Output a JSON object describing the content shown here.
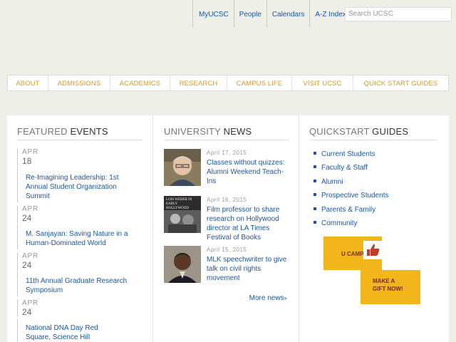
{
  "utility": {
    "links": [
      "MyUCSC",
      "People",
      "Calendars",
      "A-Z Index"
    ],
    "search_placeholder": "Search UCSC"
  },
  "nav": {
    "items": [
      "ABOUT",
      "ADMISSIONS",
      "ACADEMICS",
      "RESEARCH",
      "CAMPUS LIFE",
      "VISIT UCSC",
      "QUICK START GUIDES"
    ]
  },
  "events": {
    "heading_light": "FEATURED ",
    "heading_strong": "EVENTS",
    "items": [
      {
        "month": "APR",
        "day": "18",
        "title": "Re-Imagining Leadership: 1st Annual Student Organization Summit"
      },
      {
        "month": "APR",
        "day": "24",
        "title": "M. Sanjayan: Saving Nature in a Human-Dominated World"
      },
      {
        "month": "APR",
        "day": "24",
        "title": "11th Annual Graduate Research Symposium"
      },
      {
        "month": "APR",
        "day": "24",
        "title": "National DNA Day Red Square, Science Hill"
      }
    ]
  },
  "news": {
    "heading_light": "UNIVERSITY ",
    "heading_strong": "NEWS",
    "items": [
      {
        "date": "April 17, 2015",
        "title": "Classes without quizzes: Alumni Weekend Teach-Ins",
        "thumb_icon": "portrait-photo-icon"
      },
      {
        "date": "April 16, 2015",
        "title": "Film professor to share research on Hollywood director at LA Times Festival of Books",
        "thumb_icon": "book-cover-icon",
        "thumb_text": "LOIS WEBER IN EARLY HOLLYWOOD"
      },
      {
        "date": "April 15, 2015",
        "title": "MLK speechwriter to give talk on civil rights movement",
        "thumb_icon": "portrait-photo-icon"
      }
    ],
    "more_label": "More news",
    "more_suffix": "»"
  },
  "quickstart": {
    "heading_light": "QUICKSTART ",
    "heading_strong": "GUIDES",
    "items": [
      "Current Students",
      "Faculty & Staff",
      "Alumni",
      "Prospective Students",
      "Parents & Family",
      "Community"
    ],
    "promo1_text": "U CAMPA",
    "promo1_icon": "thumbs-up-icon",
    "promo2_line1": "MAKE A",
    "promo2_line2": "GIFT NOW!"
  },
  "colors": {
    "background": "#efeee7",
    "link_blue": "#1a57a8",
    "nav_gold": "#d79c19",
    "promo_gold": "#f2b51a",
    "promo_text": "#7b2a0d"
  }
}
